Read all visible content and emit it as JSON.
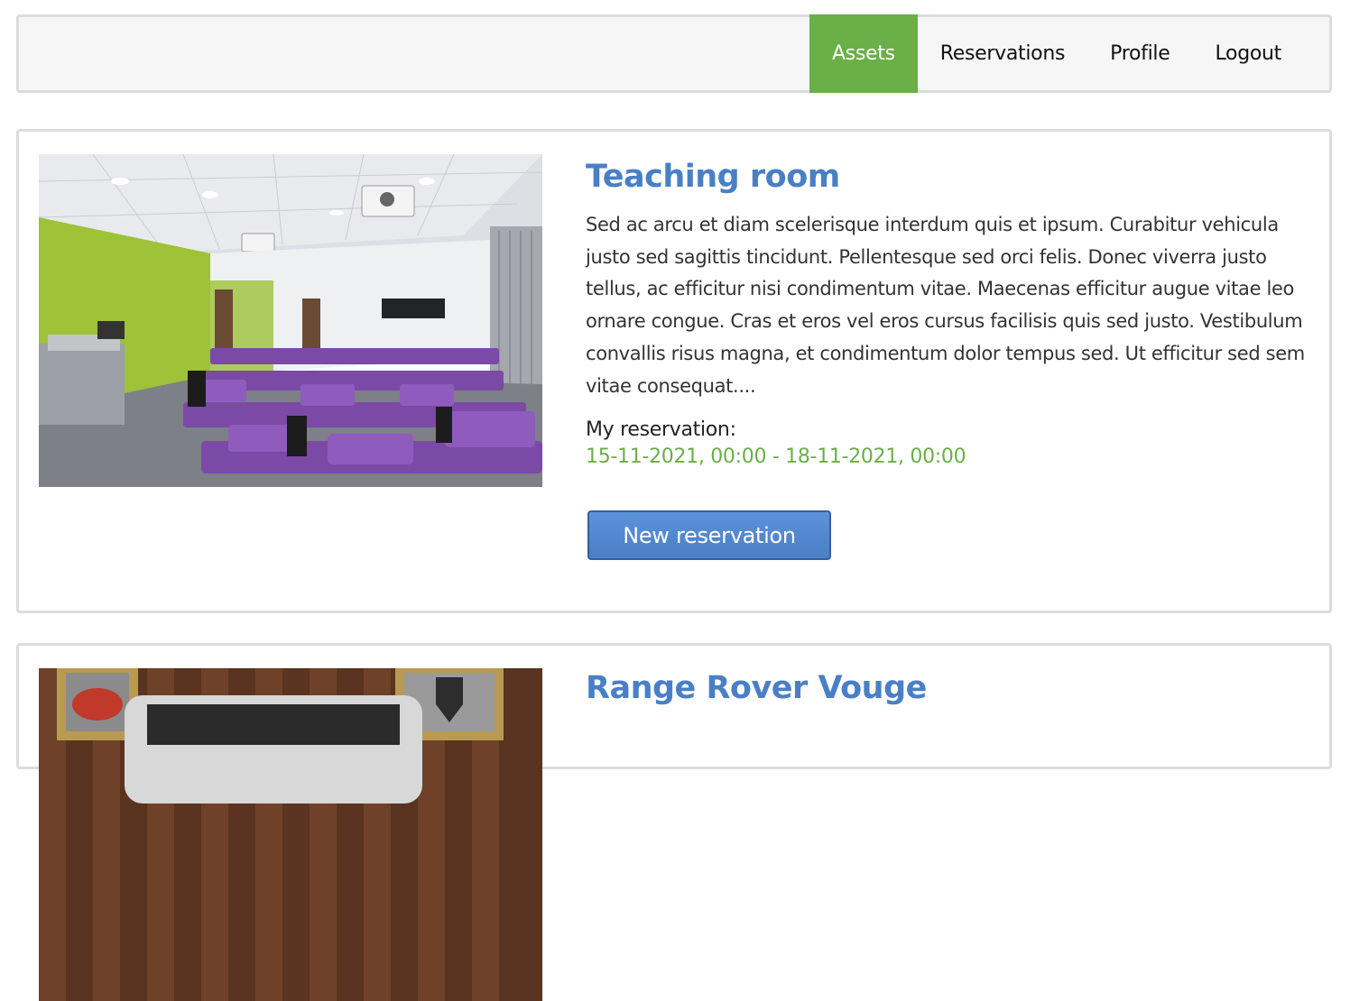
{
  "nav": {
    "items": [
      {
        "label": "Assets",
        "active": true
      },
      {
        "label": "Reservations",
        "active": false
      },
      {
        "label": "Profile",
        "active": false
      },
      {
        "label": "Logout",
        "active": false
      }
    ]
  },
  "assets": [
    {
      "title": "Teaching room",
      "description": "Sed ac arcu et diam scelerisque interdum quis et ipsum. Curabitur vehicula justo sed sagittis tincidunt. Pellentesque sed orci felis. Donec viverra justo tellus, ac efficitur nisi condimentum vitae. Maecenas efficitur augue vitae leo ornare congue. Cras et eros vel eros cursus facilisis quis sed justo. Vestibulum convallis risus magna, et condimentum dolor tempus sed. Ut efficitur sed sem vitae consequat....",
      "reservation_label": "My reservation:",
      "reservation_value": "15-11-2021, 00:00 - 18-11-2021, 00:00",
      "button_label": "New reservation"
    },
    {
      "title": "Range Rover Vouge"
    }
  ],
  "colors": {
    "accent_green": "#6aaf47",
    "title_blue": "#4a7fc6",
    "button_blue": "#4a7fc6"
  }
}
